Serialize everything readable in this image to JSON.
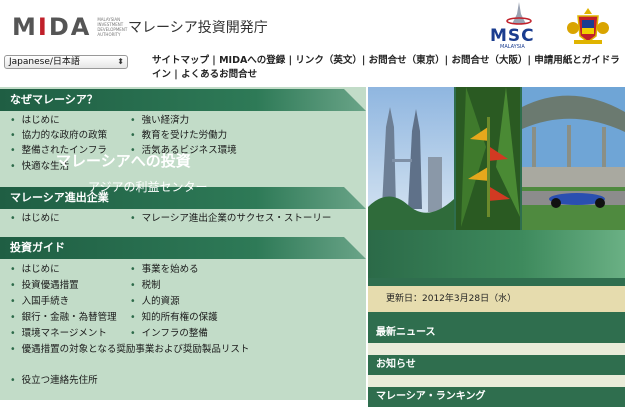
{
  "header": {
    "logo_text": "MIDA",
    "logo_subtext": "MALAYSIAN INVESTMENT DEVELOPMENT AUTHORITY",
    "title": "マレーシア投資開発庁",
    "msc_text": "MSC",
    "msc_sub": "MALAYSIA"
  },
  "language": {
    "selected": "Japanese/日本語"
  },
  "links": "サイトマップ | MIDAへの登録 | リンク（英文）| お問合せ（東京）| お問合せ（大阪）| 申請用紙とガイドライン | よくあるお問合せ",
  "sections": [
    {
      "title": "なぜマレーシア？",
      "col1": [
        "はじめに",
        "協力的な政府の政策",
        "整備されたインフラ",
        "快適な生活"
      ],
      "col2": [
        "強い経済力",
        "教育を受けた労働力",
        "活気あるビジネス環境"
      ]
    },
    {
      "title": "マレーシア進出企業",
      "col1": [
        "はじめに"
      ],
      "col2": [
        "マレーシア進出企業のサクセス・ストーリー"
      ]
    },
    {
      "title": "投資ガイド",
      "col1": [
        "はじめに",
        "投資優遇措置",
        "入国手続き",
        "銀行・金融・為替管理",
        "環境マネージメント",
        "優遇措置の対象となる奨励事業および奨励製品リスト",
        "役立つ連絡先住所"
      ],
      "col2": [
        "事業を始める",
        "税制",
        "人的資源",
        "知的所有権の保護",
        "インフラの整備"
      ]
    }
  ],
  "banner": {
    "title": "マレーシアへの投資",
    "subtitle": "アジアの利益センター"
  },
  "update": "更新日：2012年3月28日（水）",
  "right_sections": [
    "最新ニュース",
    "お知らせ",
    "マレーシア・ランキング"
  ]
}
